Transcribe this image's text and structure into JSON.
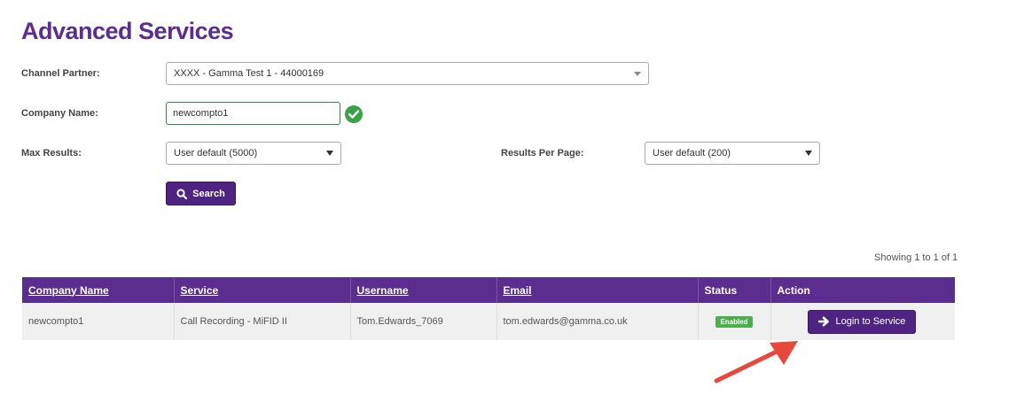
{
  "page": {
    "title": "Advanced Services"
  },
  "form": {
    "channel_partner_label": "Channel Partner:",
    "channel_partner_value": "XXXX - Gamma Test 1 - 44000169",
    "company_name_label": "Company Name:",
    "company_name_value": "newcompto1",
    "max_results_label": "Max Results:",
    "max_results_value": "User default (5000)",
    "results_per_page_label": "Results Per Page:",
    "results_per_page_value": "User default (200)",
    "search_button_label": "Search"
  },
  "results": {
    "showing_text": "Showing 1 to 1 of 1",
    "columns": [
      "Company Name",
      "Service",
      "Username",
      "Email",
      "Status",
      "Action"
    ],
    "rows": [
      {
        "company_name": "newcompto1",
        "service": "Call Recording - MiFID II",
        "username": "Tom.Edwards_7069",
        "email": "tom.edwards@gamma.co.uk",
        "status": "Enabled",
        "action_label": "Login to Service"
      }
    ]
  },
  "colors": {
    "brand_purple": "#5b2d8e",
    "button_purple": "#4e2382",
    "status_green": "#4cae4c",
    "valid_green": "#3aa34a",
    "annotation_red": "#e8473b"
  },
  "icons": {
    "valid": "check-circle-icon",
    "search": "search-icon",
    "login": "arrow-right-icon",
    "annotation": "red-arrow-annotation"
  }
}
